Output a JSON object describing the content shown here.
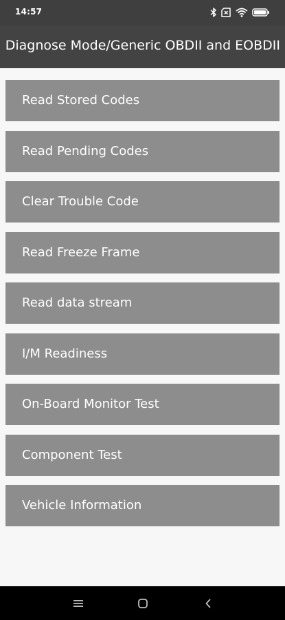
{
  "status_bar": {
    "time": "14:57",
    "icons": [
      "bluetooth-icon",
      "sim-card-icon",
      "wifi-icon",
      "battery-icon"
    ]
  },
  "header": {
    "title": "Diagnose Mode/Generic OBDII and EOBDII"
  },
  "menu": {
    "items": [
      {
        "label": "Read Stored Codes"
      },
      {
        "label": "Read Pending Codes"
      },
      {
        "label": "Clear Trouble Code"
      },
      {
        "label": "Read Freeze Frame"
      },
      {
        "label": "Read data stream"
      },
      {
        "label": "I/M Readiness"
      },
      {
        "label": "On-Board Monitor Test"
      },
      {
        "label": "Component Test"
      },
      {
        "label": "Vehicle Information"
      }
    ]
  },
  "nav_bar": {
    "buttons": [
      "menu-icon",
      "home-icon",
      "back-icon"
    ]
  },
  "colors": {
    "status_bar_bg": "#3f3f3f",
    "header_bg": "#434343",
    "menu_item_bg": "#8d8d8d",
    "page_bg": "#f7f7f7",
    "nav_bar_bg": "#000000"
  }
}
